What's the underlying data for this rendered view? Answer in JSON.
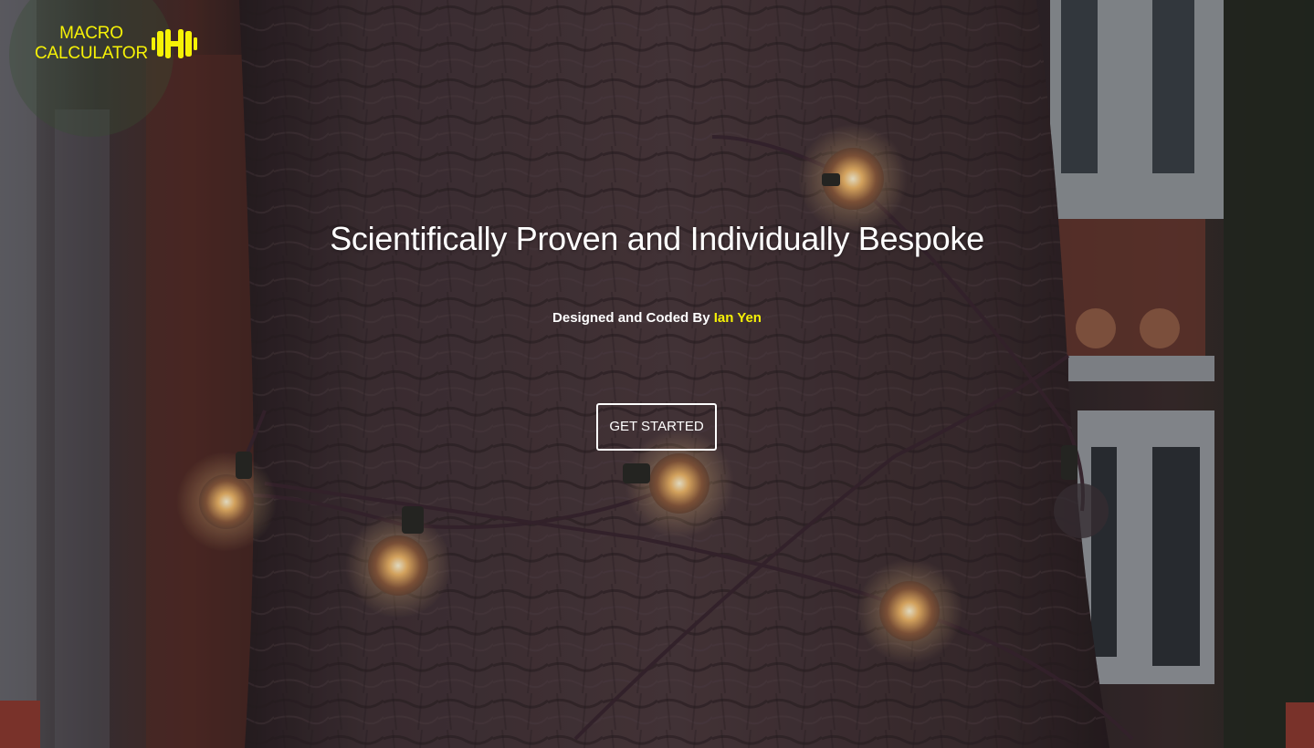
{
  "brand": {
    "line1": "MACRO",
    "line2": "CALCULATOR",
    "icon": "dumbbell-icon",
    "color": "#f6f206"
  },
  "hero": {
    "headline": "Scientifically Proven and Individually Bespoke",
    "credit_prefix": "Designed and Coded By",
    "credit_author": "Ian Yen",
    "cta_label": "GET STARTED",
    "background": "tree-with-string-lights-photo"
  },
  "colors": {
    "accent": "#f6f206",
    "text": "#ffffff"
  }
}
